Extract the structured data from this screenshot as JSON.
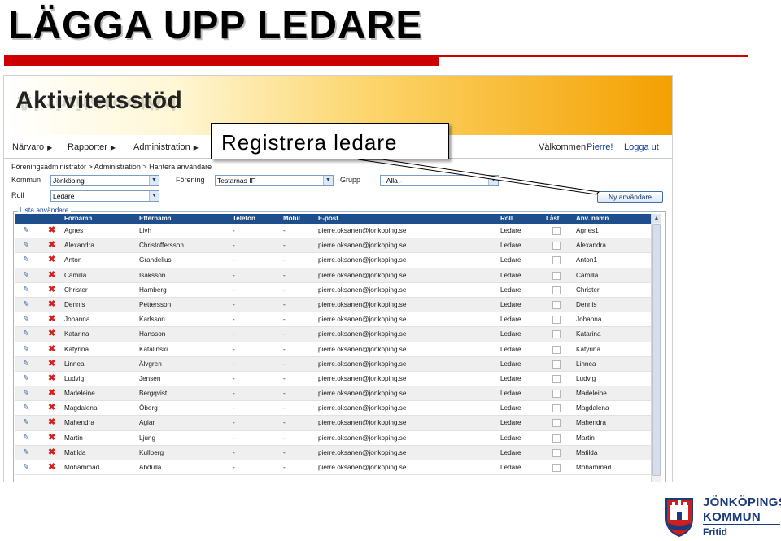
{
  "slide": {
    "title": "LÄGGA UPP LEDARE"
  },
  "app": {
    "title": "Aktivitetsstöd"
  },
  "nav": {
    "items": [
      "Närvaro",
      "Rapporter",
      "Administration"
    ],
    "welcome": "Välkommen",
    "user": "Pierre!",
    "logout": "Logga ut"
  },
  "breadcrumb": "Föreningsadministratör > Administration > Hantera användare",
  "filters": {
    "kommun_label": "Kommun",
    "kommun_value": "Jönköping",
    "forening_label": "Förening",
    "forening_value": "Testarnas IF",
    "grupp_label": "Grupp",
    "grupp_value": "- Alla -",
    "roll_label": "Roll",
    "roll_value": "Ledare"
  },
  "new_user_button": "Ny användare",
  "list": {
    "legend": "Lista användare",
    "columns": [
      "Förnamn",
      "Efternamn",
      "Telefon",
      "Mobil",
      "E-post",
      "Roll",
      "Låst",
      "Anv. namn"
    ],
    "rows": [
      [
        "Agnes",
        "Livh",
        "-",
        "-",
        "pierre.oksanen@jonkoping.se",
        "Ledare",
        "Agnes1"
      ],
      [
        "Alexandra",
        "Christoffersson",
        "-",
        "-",
        "pierre.oksanen@jonkoping.se",
        "Ledare",
        "Alexandra"
      ],
      [
        "Anton",
        "Grandelius",
        "-",
        "-",
        "pierre.oksanen@jonkoping.se",
        "Ledare",
        "Anton1"
      ],
      [
        "Camilla",
        "Isaksson",
        "-",
        "-",
        "pierre.oksanen@jonkoping.se",
        "Ledare",
        "Camilla"
      ],
      [
        "Christer",
        "Hamberg",
        "-",
        "-",
        "pierre.oksanen@jonkoping.se",
        "Ledare",
        "Christer"
      ],
      [
        "Dennis",
        "Pettersson",
        "-",
        "-",
        "pierre.oksanen@jonkoping.se",
        "Ledare",
        "Dennis"
      ],
      [
        "Johanna",
        "Karlsson",
        "-",
        "-",
        "pierre.oksanen@jonkoping.se",
        "Ledare",
        "Johanna"
      ],
      [
        "Katarina",
        "Hansson",
        "-",
        "-",
        "pierre.oksanen@jonkoping.se",
        "Ledare",
        "Katarina"
      ],
      [
        "Katyrina",
        "Katalinski",
        "-",
        "-",
        "pierre.oksanen@jonkoping.se",
        "Ledare",
        "Katyrina"
      ],
      [
        "Linnea",
        "Älvgren",
        "-",
        "-",
        "pierre.oksanen@jonkoping.se",
        "Ledare",
        "Linnea"
      ],
      [
        "Ludvig",
        "Jensen",
        "-",
        "-",
        "pierre.oksanen@jonkoping.se",
        "Ledare",
        "Ludvig"
      ],
      [
        "Madeleine",
        "Bergqvist",
        "-",
        "-",
        "pierre.oksanen@jonkoping.se",
        "Ledare",
        "Madeleine"
      ],
      [
        "Magdalena",
        "Öberg",
        "-",
        "-",
        "pierre.oksanen@jonkoping.se",
        "Ledare",
        "Magdalena"
      ],
      [
        "Mahendra",
        "Agiar",
        "-",
        "-",
        "pierre.oksanen@jonkoping.se",
        "Ledare",
        "Mahendra"
      ],
      [
        "Martin",
        "Ljung",
        "-",
        "-",
        "pierre.oksanen@jonkoping.se",
        "Ledare",
        "Martin"
      ],
      [
        "Matilda",
        "Kullberg",
        "-",
        "-",
        "pierre.oksanen@jonkoping.se",
        "Ledare",
        "Matilda"
      ],
      [
        "Mohammad",
        "Abdulla",
        "-",
        "-",
        "pierre.oksanen@jonkoping.se",
        "Ledare",
        "Mohammad"
      ]
    ]
  },
  "callout": "Registrera ledare",
  "logo": {
    "line1": "JÖNKÖPINGS",
    "line2": "KOMMUN",
    "line3": "Fritid"
  },
  "icons": {
    "edit": "pencil-icon",
    "delete": "delete-x-icon"
  },
  "colors": {
    "accent_red": "#cc0000",
    "header_blue": "#1f4e8c",
    "banner_orange": "#f4a000"
  }
}
